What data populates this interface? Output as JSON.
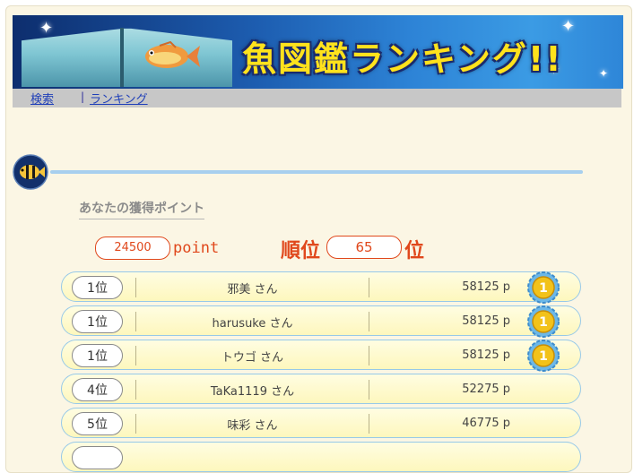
{
  "banner": {
    "title": "魚図鑑ランキング!!"
  },
  "nav": {
    "search": "検索",
    "separator": "|",
    "ranking": "ランキング"
  },
  "section": {
    "heading": "あなたの獲得ポイント"
  },
  "summary": {
    "points": "24500",
    "points_unit": "point",
    "rank_label": "順位",
    "rank": "65",
    "rank_unit": "位"
  },
  "ranking": [
    {
      "rank": "1位",
      "name": "邪美 さん",
      "points": "58125 p",
      "medal": true
    },
    {
      "rank": "1位",
      "name": "harusuke さん",
      "points": "58125 p",
      "medal": true
    },
    {
      "rank": "1位",
      "name": "トウゴ さん",
      "points": "58125 p",
      "medal": true
    },
    {
      "rank": "4位",
      "name": "TaKa1119 さん",
      "points": "52275 p",
      "medal": false
    },
    {
      "rank": "5位",
      "name": "味彩 さん",
      "points": "46775 p",
      "medal": false
    },
    {
      "rank": "",
      "name": "",
      "points": "",
      "medal": false
    }
  ],
  "colors": {
    "accent": "#e0481c",
    "link": "#1f3fb8",
    "row_border": "#97c9e8",
    "banner_text": "#ffe21c"
  }
}
